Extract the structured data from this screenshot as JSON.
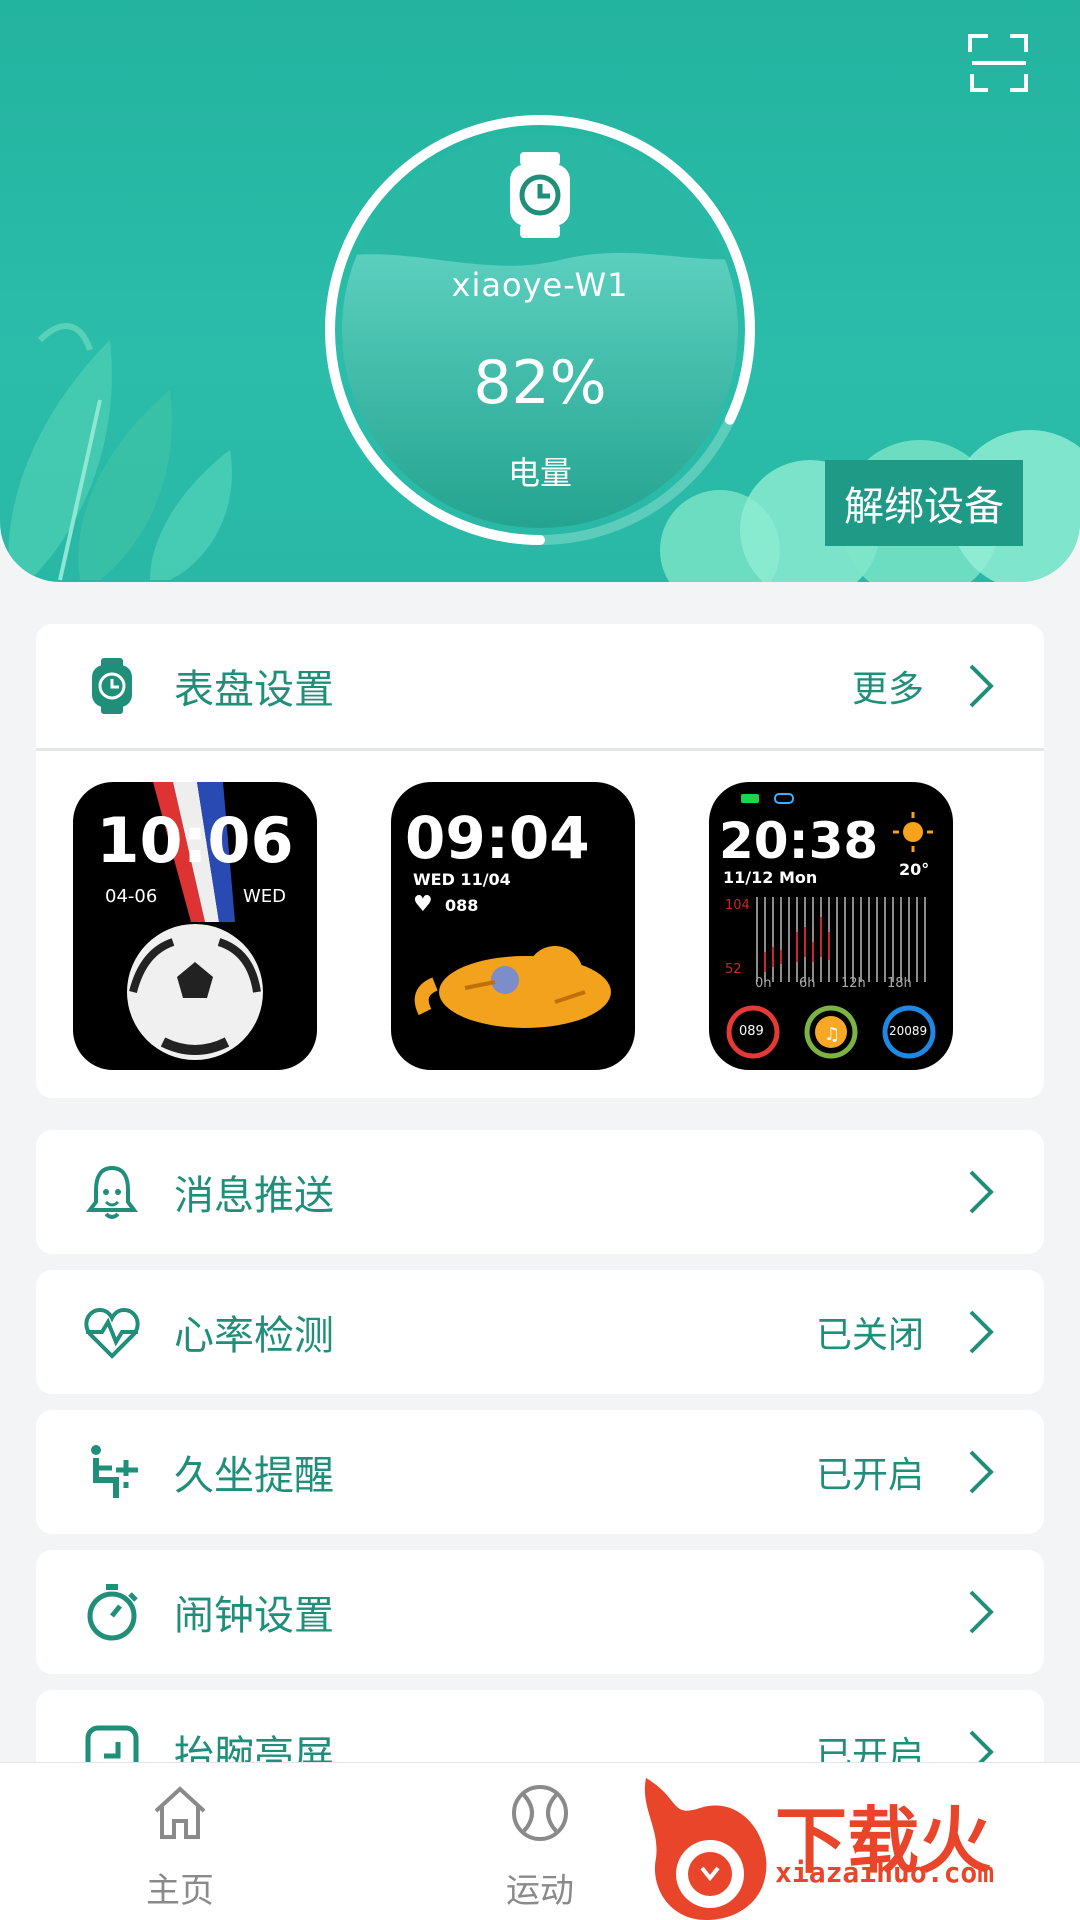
{
  "header": {
    "device_name": "xiaoye-W1",
    "battery_percent": "82%",
    "battery_value": 82,
    "battery_label": "电量",
    "unbind_label": "解绑设备"
  },
  "watchface_section": {
    "title": "表盘设置",
    "more_label": "更多",
    "faces": [
      {
        "time": "10:06",
        "date": "04-06",
        "weekday": "WED"
      },
      {
        "time": "09:04",
        "date": "WED 11/04",
        "heart": "088"
      },
      {
        "time": "20:38",
        "date": "11/12 Mon",
        "temp": "20°",
        "hr_max": "104",
        "hr_min": "52",
        "ticks": [
          "0h",
          "6h",
          "12h",
          "18h"
        ],
        "gauge1": "089",
        "gauge3": "20089"
      }
    ]
  },
  "settings": [
    {
      "label": "消息推送",
      "status": ""
    },
    {
      "label": "心率检测",
      "status": "已关闭"
    },
    {
      "label": "久坐提醒",
      "status": "已开启"
    },
    {
      "label": "闹钟设置",
      "status": ""
    },
    {
      "label": "抬腕亮屏",
      "status": "已开启"
    }
  ],
  "bottom_nav": [
    {
      "label": "主页",
      "icon": "home-icon"
    },
    {
      "label": "运动",
      "icon": "sport-ball-icon"
    }
  ],
  "watermark": {
    "brand": "下载火",
    "url": "xiazaihuo.com"
  },
  "colors": {
    "primary": "#23b39f",
    "text": "#1f8f7a",
    "button": "#1f9a86",
    "accent": "#e8452a"
  }
}
